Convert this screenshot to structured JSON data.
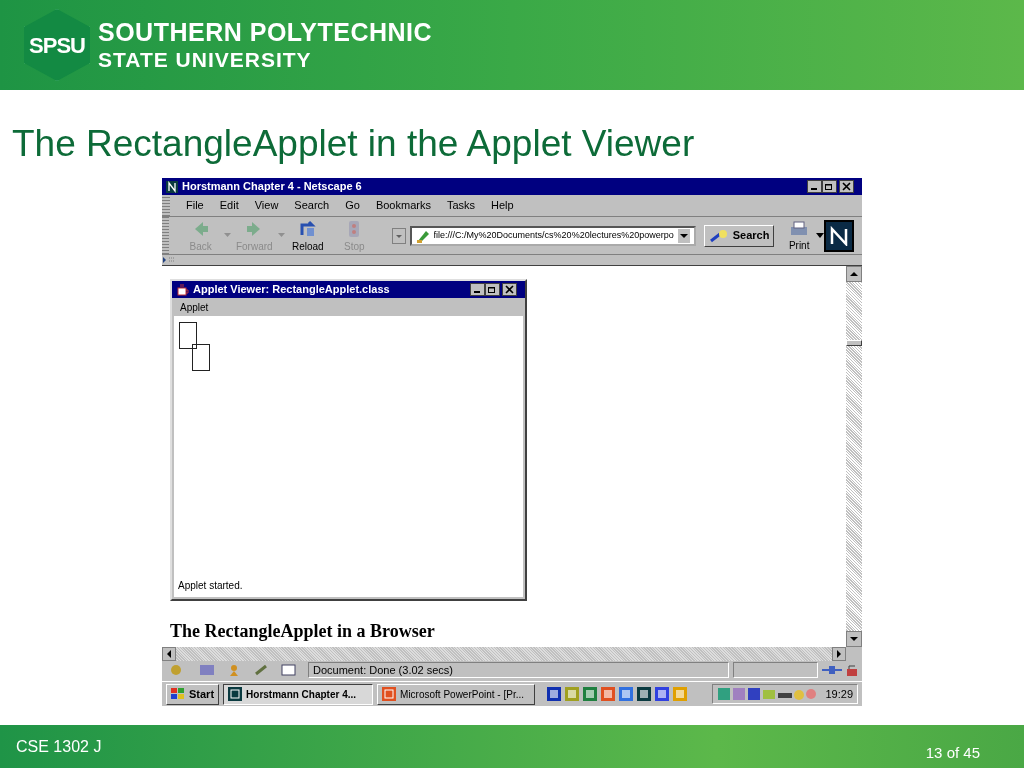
{
  "header": {
    "logo_mark": "SPSU",
    "line1": "SOUTHERN POLYTECHNIC",
    "line2": "STATE UNIVERSITY"
  },
  "slide_title": "The RectangleApplet in the Applet Viewer",
  "browser": {
    "title": "Horstmann Chapter 4 - Netscape 6",
    "menus": [
      "File",
      "Edit",
      "View",
      "Search",
      "Go",
      "Bookmarks",
      "Tasks",
      "Help"
    ],
    "toolbar": [
      {
        "label": "Back",
        "kind": "back",
        "disabled": true
      },
      {
        "label": "Forward",
        "kind": "forward",
        "disabled": true
      },
      {
        "label": "Reload",
        "kind": "reload",
        "disabled": false
      },
      {
        "label": "Stop",
        "kind": "stop",
        "disabled": true
      }
    ],
    "url": "file:///C:/My%20Documents/cs%20%20lectures%20powerpo",
    "search_button": "Search",
    "print_button": "Print",
    "applet_window": {
      "title": "Applet Viewer: RectangleApplet.class",
      "menu": "Applet",
      "status": "Applet started."
    },
    "page_heading": "The RectangleApplet in a Browser",
    "status_text": "Document: Done (3.02 secs)"
  },
  "taskbar": {
    "start": "Start",
    "tasks": [
      {
        "label": "Horstmann Chapter 4...",
        "selected": true
      },
      {
        "label": "Microsoft PowerPoint - [Pr...",
        "selected": false
      }
    ],
    "clock": "19:29"
  },
  "footer": {
    "course": "CSE 1302 J",
    "page": "13 of 45"
  }
}
